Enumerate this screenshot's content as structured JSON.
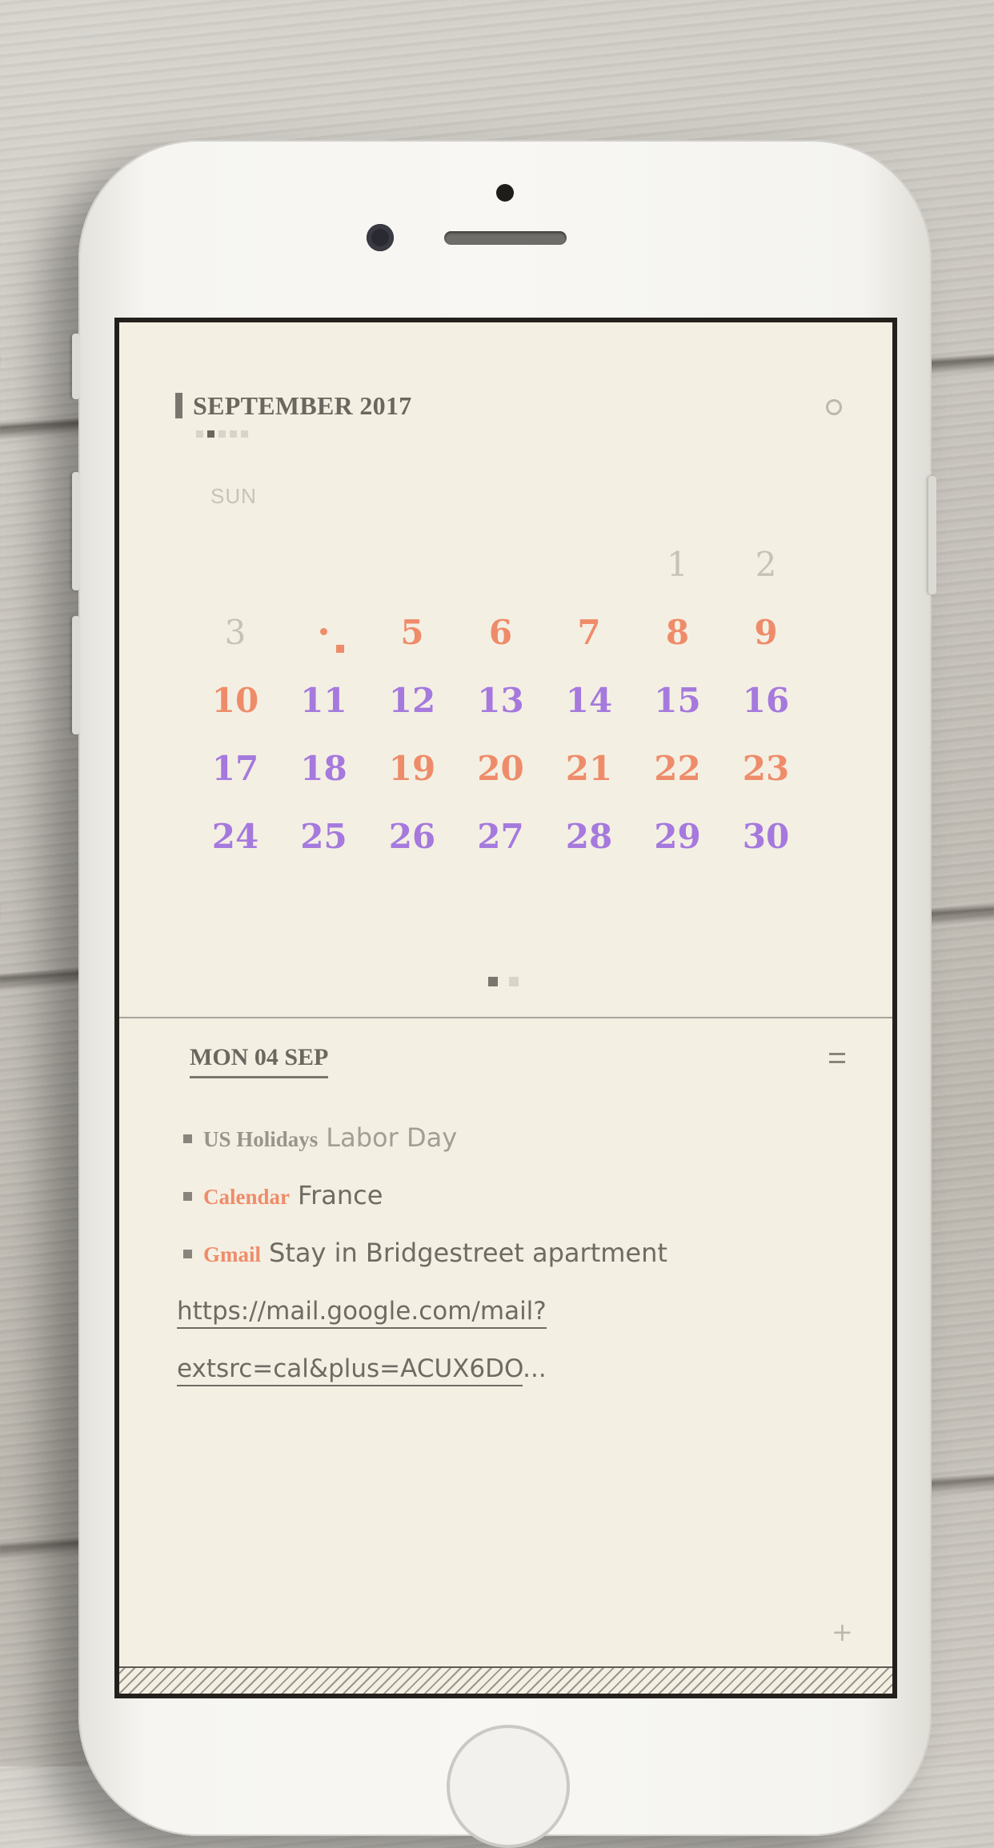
{
  "calendar": {
    "month_title": "SEPTEMBER 2017",
    "day_of_week_label": "SUN",
    "weeks": [
      [
        {
          "d": "",
          "c": ""
        },
        {
          "d": "",
          "c": ""
        },
        {
          "d": "",
          "c": ""
        },
        {
          "d": "",
          "c": ""
        },
        {
          "d": "",
          "c": ""
        },
        {
          "d": "1",
          "c": "gray"
        },
        {
          "d": "2",
          "c": "gray"
        }
      ],
      [
        {
          "d": "3",
          "c": "gray"
        },
        {
          "d": "",
          "c": "today"
        },
        {
          "d": "5",
          "c": "orange"
        },
        {
          "d": "6",
          "c": "orange"
        },
        {
          "d": "7",
          "c": "orange"
        },
        {
          "d": "8",
          "c": "orange"
        },
        {
          "d": "9",
          "c": "orange"
        }
      ],
      [
        {
          "d": "10",
          "c": "orange"
        },
        {
          "d": "11",
          "c": "purple"
        },
        {
          "d": "12",
          "c": "purple"
        },
        {
          "d": "13",
          "c": "purple"
        },
        {
          "d": "14",
          "c": "purple"
        },
        {
          "d": "15",
          "c": "purple"
        },
        {
          "d": "16",
          "c": "purple"
        }
      ],
      [
        {
          "d": "17",
          "c": "purple"
        },
        {
          "d": "18",
          "c": "purple"
        },
        {
          "d": "19",
          "c": "orange"
        },
        {
          "d": "20",
          "c": "orange"
        },
        {
          "d": "21",
          "c": "orange"
        },
        {
          "d": "22",
          "c": "orange"
        },
        {
          "d": "23",
          "c": "orange"
        }
      ],
      [
        {
          "d": "24",
          "c": "purple"
        },
        {
          "d": "25",
          "c": "purple"
        },
        {
          "d": "26",
          "c": "purple"
        },
        {
          "d": "27",
          "c": "purple"
        },
        {
          "d": "28",
          "c": "purple"
        },
        {
          "d": "29",
          "c": "purple"
        },
        {
          "d": "30",
          "c": "purple"
        }
      ]
    ],
    "colors": {
      "orange": "#ee8c6a",
      "purple": "#a579dd",
      "gray": "#c6c2b8"
    }
  },
  "agenda": {
    "selected_date": "MON 04 SEP",
    "events": [
      {
        "source": "US Holidays",
        "title": "Labor Day"
      },
      {
        "source": "Calendar",
        "title": "France"
      },
      {
        "source": "Gmail",
        "title": "Stay in Bridgestreet apartment"
      }
    ],
    "link_line1": "https://mail.google.com/mail?",
    "link_line2": "extsrc=cal&plus=ACUX6DO",
    "link_ellipsis": "...",
    "add_label": "+"
  }
}
